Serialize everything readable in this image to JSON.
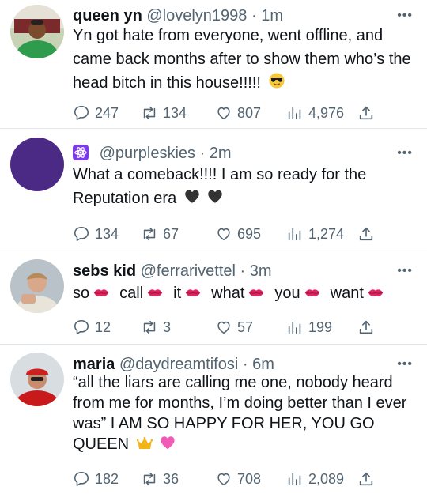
{
  "tweets": [
    {
      "name": "queen yn",
      "handle": "@lovelyn1998",
      "time": "· 1m",
      "text": "Yn got hate from everyone, went offline, and came back months after to show them who’s the head bitch in this house!!!!!",
      "emoji": "sunglasses",
      "replies": "247",
      "retweets": "134",
      "likes": "807",
      "views": "4,976"
    },
    {
      "name": "",
      "handle": "@purpleskies",
      "time": "· 2m",
      "text": "What a comeback!!!! I am so ready for the Reputation era",
      "emoji": "black-hearts",
      "replies": "134",
      "retweets": "67",
      "likes": "695",
      "views": "1,274"
    },
    {
      "name": "sebs kid",
      "handle": "@ferrarivettel",
      "time": "· 3m",
      "words": [
        "so",
        "call",
        "it",
        "what",
        "you",
        "want"
      ],
      "replies": "12",
      "retweets": "3",
      "likes": "57",
      "views": "199"
    },
    {
      "name": "maria",
      "handle": "@daydreamtifosi",
      "time": "· 6m",
      "text": "“all the liars are calling me one, nobody heard from me for months, I’m doing better than I ever was” I AM SO HAPPY FOR HER, YOU GO QUEEN",
      "emoji": "crown-heart",
      "replies": "182",
      "retweets": "36",
      "likes": "708",
      "views": "2,089"
    }
  ],
  "more_glyph": "•••",
  "colors": {
    "muted": "#536471",
    "text": "#0f1419",
    "kiss": "#e0245e",
    "purple": "#4b2a86"
  }
}
